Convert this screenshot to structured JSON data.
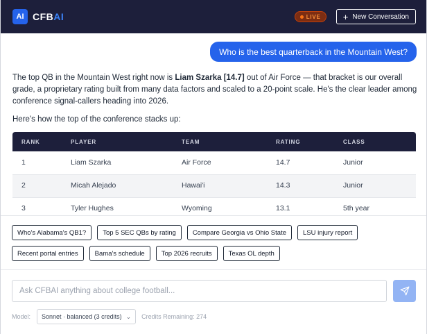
{
  "header": {
    "logo": "AI",
    "brand_main": "CFB",
    "brand_accent": "AI",
    "live_label": "LIVE",
    "new_conversation_label": "New Conversation",
    "colors": {
      "header_bg": "#1d1f3b",
      "accent": "#2563eb",
      "live": "#f97316"
    }
  },
  "conversation": {
    "user_message": "Who is the best quarterback in the Mountain West?",
    "answer": {
      "para1_pre": "The top QB in the Mountain West right now is ",
      "para1_bold": "Liam Szarka [14.7]",
      "para1_post": " out of Air Force — that bracket is our overall grade, a proprietary rating built from many data factors and scaled to a 20-point scale. He's the clear leader among conference signal-callers heading into 2026.",
      "para2": "Here's how the top of the conference stacks up:"
    },
    "table": {
      "headers": [
        "RANK",
        "PLAYER",
        "TEAM",
        "RATING",
        "CLASS"
      ],
      "rows": [
        [
          "1",
          "Liam Szarka",
          "Air Force",
          "14.7",
          "Junior"
        ],
        [
          "2",
          "Micah Alejado",
          "Hawai'i",
          "14.3",
          "Junior"
        ],
        [
          "3",
          "Tyler Hughes",
          "Wyoming",
          "13.1",
          "5th year"
        ]
      ]
    }
  },
  "suggestions": [
    "Who's Alabama's QB1?",
    "Top 5 SEC QBs by rating",
    "Compare Georgia vs Ohio State",
    "LSU injury report",
    "Recent portal entries",
    "Bama's schedule",
    "Top 2026 recruits",
    "Texas OL depth"
  ],
  "composer": {
    "placeholder": "Ask CFBAI anything about college football...",
    "model_label": "Model:",
    "model_value": "Sonnet · balanced (3 credits)",
    "credits_label": "Credits Remaining: 274",
    "send_icon": "send-icon"
  }
}
